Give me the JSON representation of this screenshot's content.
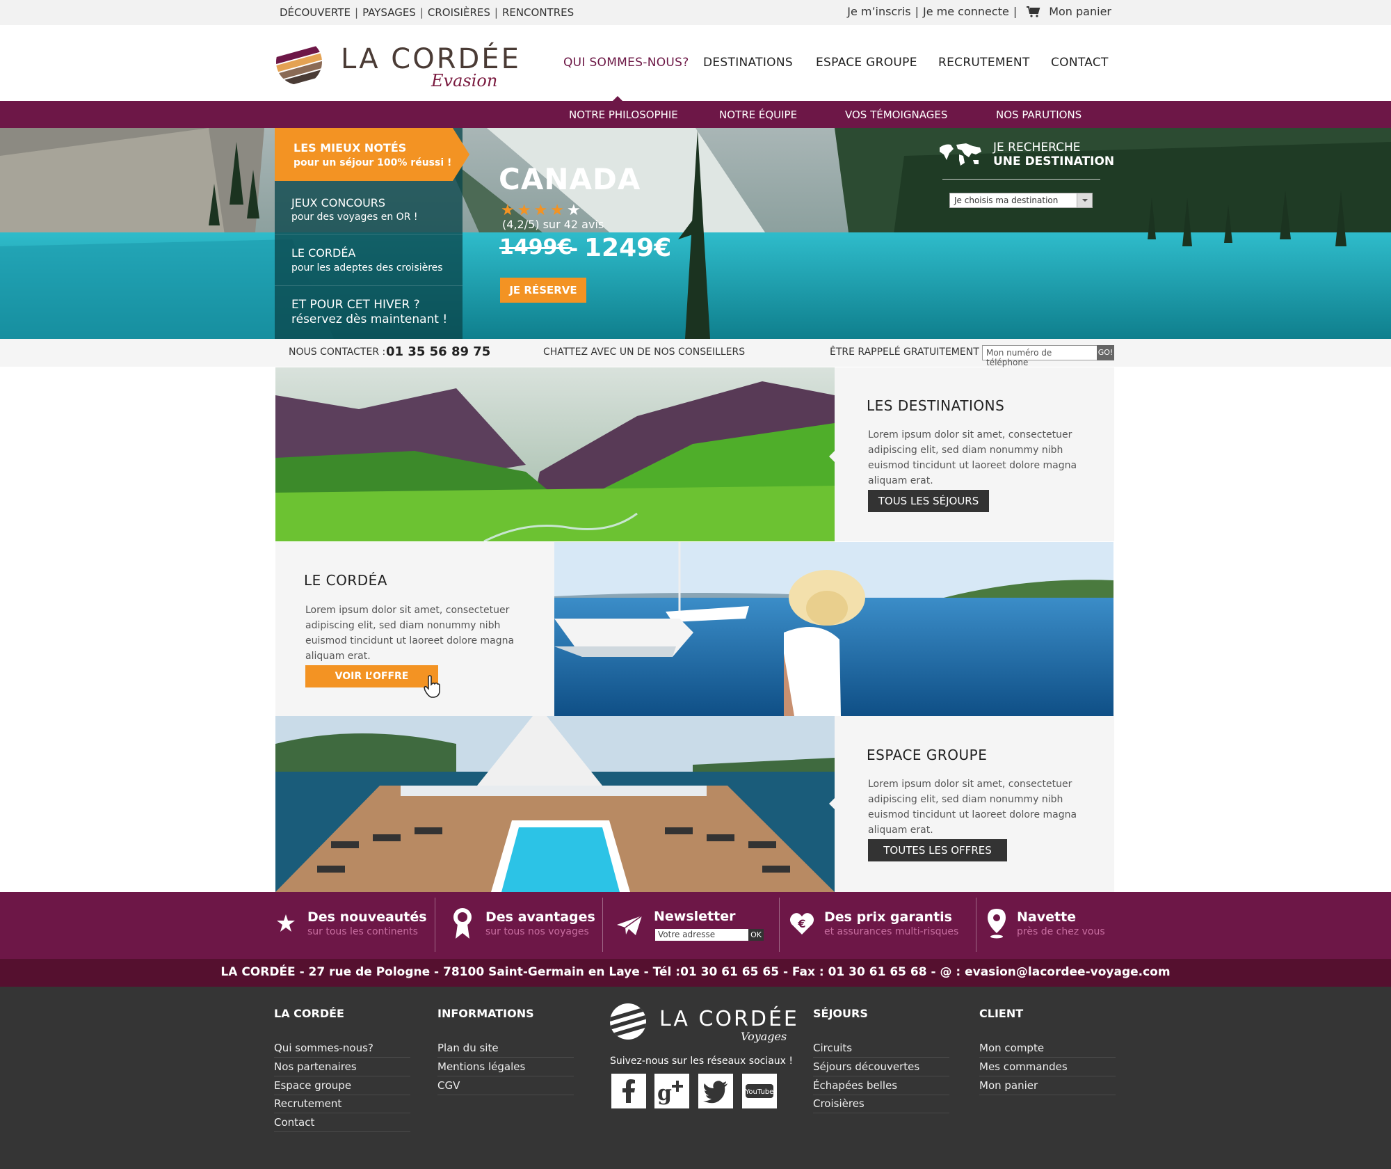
{
  "topbar": {
    "links": [
      "DÉCOUVERTE",
      "PAYSAGES",
      "CROISIÈRES",
      "RENCONTRES"
    ],
    "signup": "Je m’inscris",
    "login": "Je me connecte",
    "cart": "Mon panier"
  },
  "brand": {
    "name": "LA CORDÉE",
    "tagline": "Evasion"
  },
  "nav": {
    "items": [
      "QUI SOMMES-NOUS?",
      "DESTINATIONS",
      "ESPACE GROUPE",
      "RECRUTEMENT",
      "CONTACT"
    ],
    "active": "QUI SOMMES-NOUS?"
  },
  "subnav": [
    "NOTRE PHILOSOPHIE",
    "NOTRE ÉQUIPE",
    "VOS TÉMOIGNAGES",
    "NOS PARUTIONS"
  ],
  "hero": {
    "side": [
      {
        "title": "LES MIEUX NOTÉS",
        "sub": "pour un séjour 100% réussi !"
      },
      {
        "title": "JEUX CONCOURS",
        "sub": "pour des voyages en OR !"
      },
      {
        "title": "LE CORDÉA",
        "sub": "pour les adeptes des croisières"
      },
      {
        "title": "ET POUR CET HIVER ?",
        "sub": "réservez dès maintenant !"
      }
    ],
    "destination": "CANADA",
    "stars": 4,
    "rating": "(4,2/5) sur 42 avis",
    "price_old": "1499€",
    "price_sep": "-",
    "price_new": "1249€",
    "cta": "JE RÉSERVE",
    "search_title_1": "JE RECHERCHE",
    "search_title_2": "UNE DESTINATION",
    "search_select": "Je choisis ma destination"
  },
  "contact": {
    "label": "NOUS CONTACTER :",
    "phone": "01 35 56 89 75",
    "chat": "CHATTEZ AVEC UN DE NOS CONSEILLERS",
    "callback": "ÊTRE RAPPELÉ GRATUITEMENT :",
    "placeholder": "Mon numéro de téléphone",
    "go": "GO!"
  },
  "blocks": [
    {
      "title": "LES DESTINATIONS",
      "text": "Lorem ipsum dolor sit amet, consectetuer adipiscing elit, sed diam nonummy nibh euismod tincidunt ut laoreet dolore magna aliquam erat.",
      "button": "TOUS LES SÉJOURS"
    },
    {
      "title": "LE CORDÉA",
      "text": "Lorem ipsum dolor sit amet, consectetuer adipiscing elit, sed diam nonummy nibh euismod tincidunt ut laoreet dolore magna aliquam erat.",
      "button": "VOIR L’OFFRE"
    },
    {
      "title": "ESPACE GROUPE",
      "text": "Lorem ipsum dolor sit amet, consectetuer adipiscing elit, sed diam nonummy nibh euismod tincidunt ut laoreet dolore magna aliquam erat.",
      "button": "TOUTES LES OFFRES"
    }
  ],
  "features": [
    {
      "title": "Des nouveautés",
      "sub": "sur tous les continents",
      "icon": "star-icon"
    },
    {
      "title": "Des avantages",
      "sub": "sur tous nos voyages",
      "icon": "award-icon"
    },
    {
      "title": "Newsletter",
      "placeholder": "Votre adresse",
      "ok": "OK",
      "icon": "paper-plane-icon"
    },
    {
      "title": "Des prix garantis",
      "sub": "et assurances multi-risques",
      "icon": "heart-euro-icon"
    },
    {
      "title": "Navette",
      "sub": "près de chez vous",
      "icon": "map-pin-icon"
    }
  ],
  "address": "LA CORDÉE - 27 rue de Pologne - 78100 Saint-Germain en Laye - Tél :01 30 61 65 65 - Fax : 01 30 61 65 68 - @ : evasion@lacordee-voyage.com",
  "footer": {
    "col1": {
      "title": "LA CORDÉE",
      "links": [
        "Qui sommes-nous?",
        "Nos partenaires",
        "Espace groupe",
        "Recrutement",
        "Contact"
      ]
    },
    "col2": {
      "title": "INFORMATIONS",
      "links": [
        "Plan du site",
        "Mentions légales",
        "CGV"
      ]
    },
    "logo_name": "LA CORDÉE",
    "logo_sub": "Voyages",
    "social_text": "Suivez-nous sur les réseaux sociaux !",
    "social": [
      "facebook-icon",
      "google-plus-icon",
      "twitter-icon",
      "youtube-icon"
    ],
    "col3": {
      "title": "SÉJOURS",
      "links": [
        "Circuits",
        "Séjours découvertes",
        "Échapées belles",
        "Croisières"
      ]
    },
    "col4": {
      "title": "CLIENT",
      "links": [
        "Mon compte",
        "Mes commandes",
        "Mon panier"
      ]
    }
  },
  "colors": {
    "primary": "#6d1747",
    "accent": "#f39323",
    "dark": "#353535"
  }
}
